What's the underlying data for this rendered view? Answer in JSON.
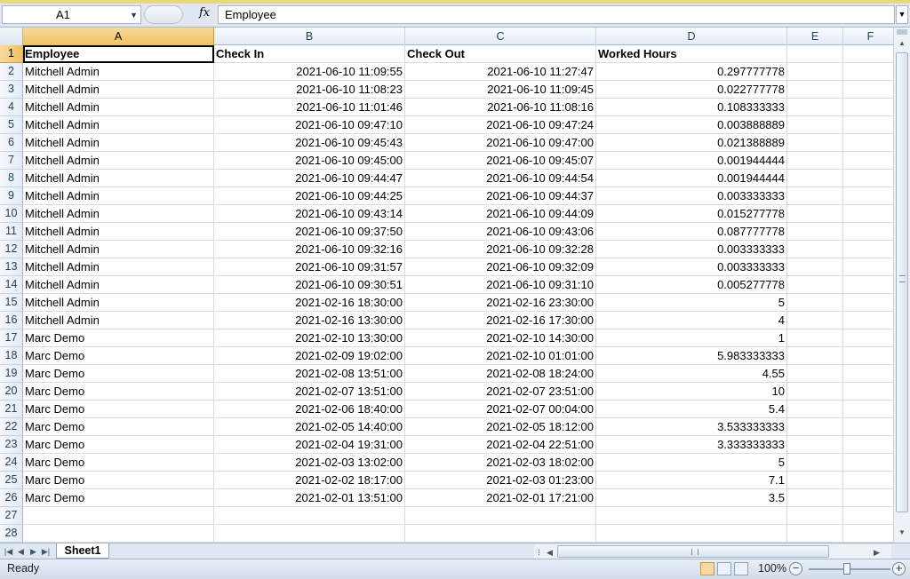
{
  "formula_bar": {
    "name_box": "A1",
    "fx_label": "fx",
    "formula": "Employee"
  },
  "grid": {
    "columns": [
      "A",
      "B",
      "C",
      "D",
      "E",
      "F"
    ],
    "row_numbers": [
      "1",
      "2",
      "3",
      "4",
      "5",
      "6",
      "7",
      "8",
      "9",
      "10",
      "11",
      "12",
      "13",
      "14",
      "15",
      "16",
      "17",
      "18",
      "19",
      "20",
      "21",
      "22",
      "23",
      "24",
      "25",
      "26",
      "27",
      "28"
    ],
    "header": [
      "Employee",
      "Check In",
      "Check Out",
      "Worked Hours"
    ],
    "rows": [
      [
        "Mitchell Admin",
        "2021-06-10 11:09:55",
        "2021-06-10 11:27:47",
        "0.297777778"
      ],
      [
        "Mitchell Admin",
        "2021-06-10 11:08:23",
        "2021-06-10 11:09:45",
        "0.022777778"
      ],
      [
        "Mitchell Admin",
        "2021-06-10 11:01:46",
        "2021-06-10 11:08:16",
        "0.108333333"
      ],
      [
        "Mitchell Admin",
        "2021-06-10 09:47:10",
        "2021-06-10 09:47:24",
        "0.003888889"
      ],
      [
        "Mitchell Admin",
        "2021-06-10 09:45:43",
        "2021-06-10 09:47:00",
        "0.021388889"
      ],
      [
        "Mitchell Admin",
        "2021-06-10 09:45:00",
        "2021-06-10 09:45:07",
        "0.001944444"
      ],
      [
        "Mitchell Admin",
        "2021-06-10 09:44:47",
        "2021-06-10 09:44:54",
        "0.001944444"
      ],
      [
        "Mitchell Admin",
        "2021-06-10 09:44:25",
        "2021-06-10 09:44:37",
        "0.003333333"
      ],
      [
        "Mitchell Admin",
        "2021-06-10 09:43:14",
        "2021-06-10 09:44:09",
        "0.015277778"
      ],
      [
        "Mitchell Admin",
        "2021-06-10 09:37:50",
        "2021-06-10 09:43:06",
        "0.087777778"
      ],
      [
        "Mitchell Admin",
        "2021-06-10 09:32:16",
        "2021-06-10 09:32:28",
        "0.003333333"
      ],
      [
        "Mitchell Admin",
        "2021-06-10 09:31:57",
        "2021-06-10 09:32:09",
        "0.003333333"
      ],
      [
        "Mitchell Admin",
        "2021-06-10 09:30:51",
        "2021-06-10 09:31:10",
        "0.005277778"
      ],
      [
        "Mitchell Admin",
        "2021-02-16 18:30:00",
        "2021-02-16 23:30:00",
        "5"
      ],
      [
        "Mitchell Admin",
        "2021-02-16 13:30:00",
        "2021-02-16 17:30:00",
        "4"
      ],
      [
        "Marc Demo",
        "2021-02-10 13:30:00",
        "2021-02-10 14:30:00",
        "1"
      ],
      [
        "Marc Demo",
        "2021-02-09 19:02:00",
        "2021-02-10 01:01:00",
        "5.983333333"
      ],
      [
        "Marc Demo",
        "2021-02-08 13:51:00",
        "2021-02-08 18:24:00",
        "4.55"
      ],
      [
        "Marc Demo",
        "2021-02-07 13:51:00",
        "2021-02-07 23:51:00",
        "10"
      ],
      [
        "Marc Demo",
        "2021-02-06 18:40:00",
        "2021-02-07 00:04:00",
        "5.4"
      ],
      [
        "Marc Demo",
        "2021-02-05 14:40:00",
        "2021-02-05 18:12:00",
        "3.533333333"
      ],
      [
        "Marc Demo",
        "2021-02-04 19:31:00",
        "2021-02-04 22:51:00",
        "3.333333333"
      ],
      [
        "Marc Demo",
        "2021-02-03 13:02:00",
        "2021-02-03 18:02:00",
        "5"
      ],
      [
        "Marc Demo",
        "2021-02-02 18:17:00",
        "2021-02-03 01:23:00",
        "7.1"
      ],
      [
        "Marc Demo",
        "2021-02-01 13:51:00",
        "2021-02-01 17:21:00",
        "3.5"
      ]
    ]
  },
  "sheet_tabs": [
    "Sheet1"
  ],
  "status": {
    "text": "Ready",
    "zoom": "100%",
    "zoom_out": "−",
    "zoom_in": "+"
  }
}
